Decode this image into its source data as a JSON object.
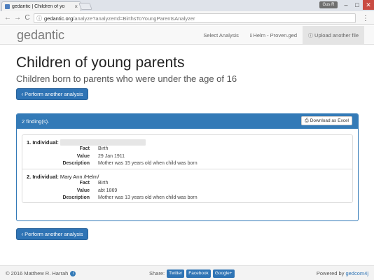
{
  "browser": {
    "tab_title": "gedantic | Children of yo",
    "tab_close": "×",
    "user_badge": "Gus R",
    "win_min": "–",
    "win_max": "□",
    "win_close": "✕",
    "url_host": "gedantic.org",
    "url_path": "/analyze?analyzerId=BirthsToYoungParentsAnalyzer",
    "back_icon": "←",
    "forward_icon": "→",
    "reload_icon": "C",
    "info_icon": "ⓘ",
    "star_icon": "☆",
    "menu_icon": "⋮"
  },
  "nav": {
    "brand": "gedantic",
    "select_analysis": "Select Analysis",
    "file_label": "Helm - Proven.ged",
    "upload_label": "Upload another file",
    "info_icon": "ℹ",
    "upload_icon": "ⓘ"
  },
  "main": {
    "title": "Children of young parents",
    "subtitle": "Children born to parents who were under the age of 16",
    "perform_label": "Perform another analysis",
    "chevron_icon": "‹"
  },
  "panel": {
    "findings_count": "2 finding(s).",
    "download_label": "Download as Excel",
    "download_icon": "⎙",
    "findings": [
      {
        "title_prefix": "1. Individual:",
        "name": "",
        "fact_label": "Fact",
        "fact": "Birth",
        "value_label": "Value",
        "value": "29 Jan 1911",
        "description_label": "Description",
        "description": "Mother was 15 years old when child was born"
      },
      {
        "title_prefix": "2. Individual:",
        "name": "Mary Ann /Helm/",
        "fact_label": "Fact",
        "fact": "Birth",
        "value_label": "Value",
        "value": "abt 1869",
        "description_label": "Description",
        "description": "Mother was 13 years old when child was born"
      }
    ]
  },
  "footer": {
    "copyright": "© 2016 Matthew R. Harrah",
    "info_icon": "i",
    "share_label": "Share:",
    "twitter": "Twitter",
    "facebook": "Facebook",
    "googleplus": "Google+",
    "powered_label": "Powered by",
    "powered_link": "gedcom4j"
  }
}
